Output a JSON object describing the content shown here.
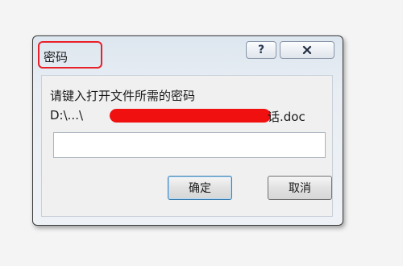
{
  "dialog": {
    "title": "密码",
    "help_label": "?",
    "prompt": "请键入打开文件所需的密码",
    "path_prefix": "D:\\...\\",
    "path_suffix": "话.doc",
    "password_value": "",
    "ok_label": "确定",
    "cancel_label": "取消"
  },
  "colors": {
    "highlight": "#e8202a",
    "redaction": "#f01010"
  },
  "icons": {
    "help": "question-icon",
    "close": "close-icon"
  }
}
